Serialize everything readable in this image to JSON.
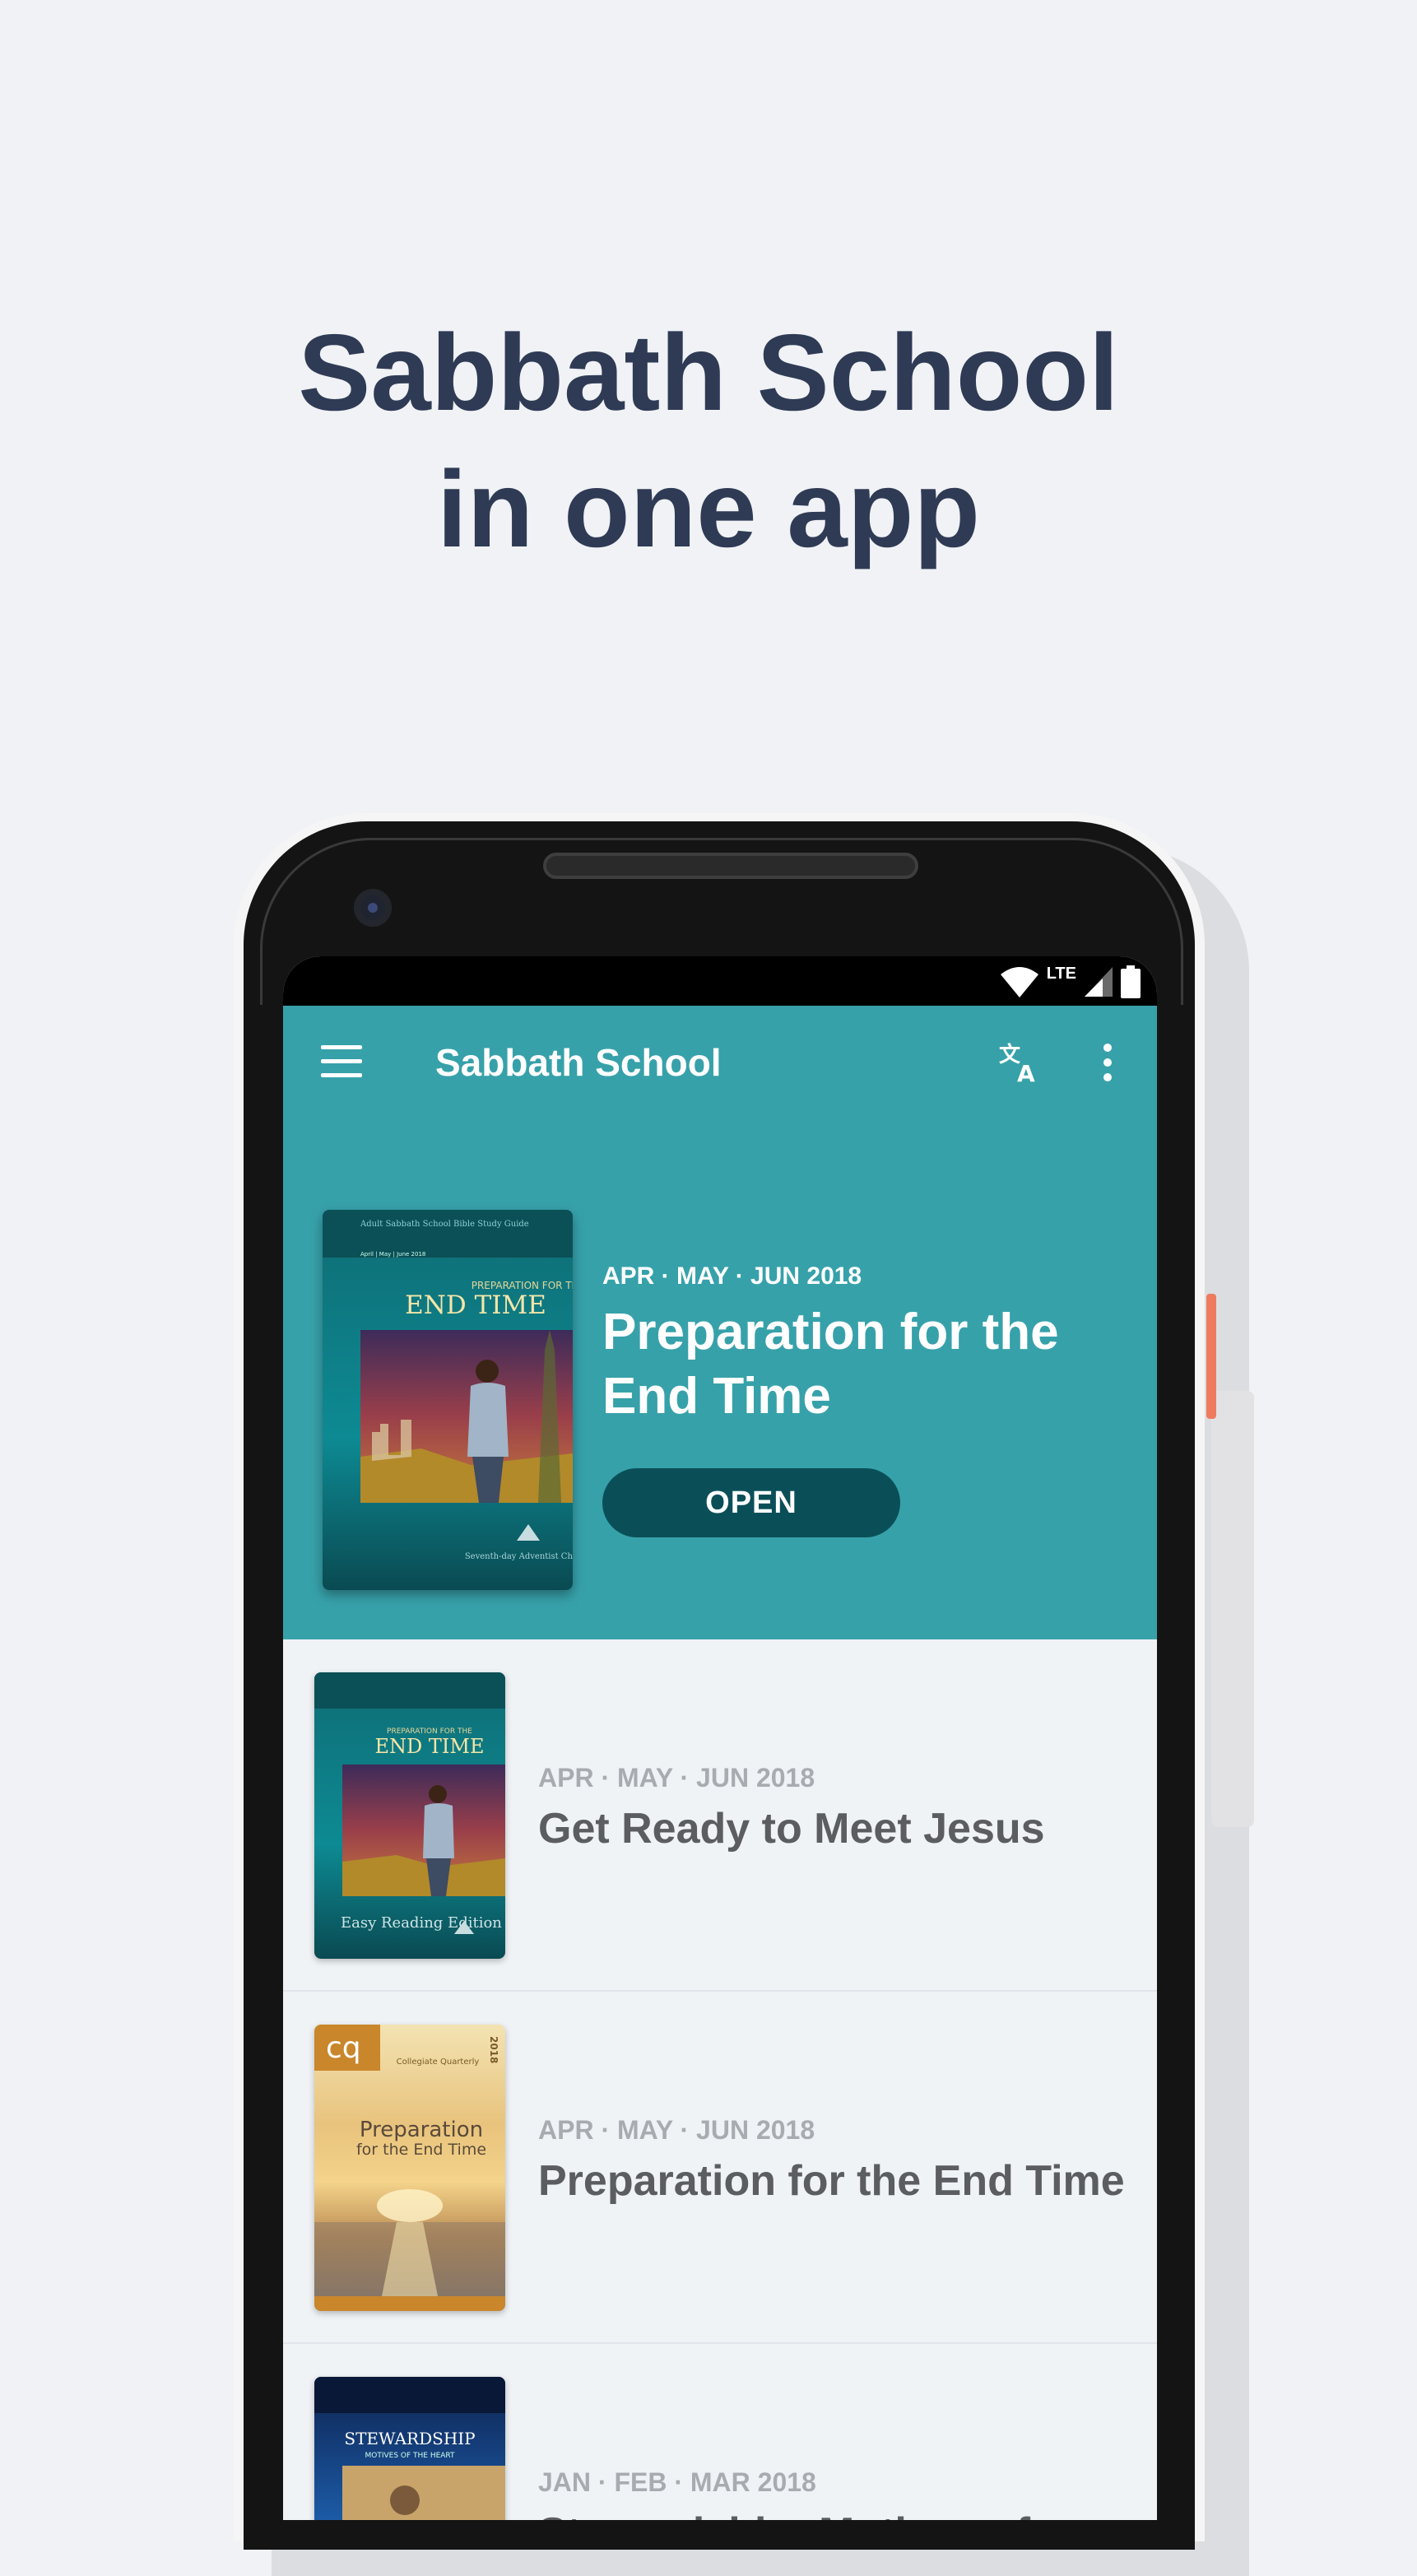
{
  "headline": {
    "line1": "Sabbath School",
    "line2": "in one app"
  },
  "status_bar": {
    "network_label": "LTE",
    "icons": [
      "wifi-icon",
      "cell-signal-icon",
      "battery-icon"
    ]
  },
  "app_bar": {
    "title": "Sabbath School",
    "icons": [
      "menu-icon",
      "translate-icon",
      "more-vert-icon"
    ],
    "color": "#37a1aa"
  },
  "featured": {
    "quarter": "APR · MAY · JUN 2018",
    "title": "Preparation for the End Time",
    "open_label": "OPEN",
    "cover": {
      "series": "Adult Sabbath School Bible Study Guide",
      "dates": "April | May | June 2018",
      "kicker": "PREPARATION FOR THE",
      "title": "END TIME",
      "publisher": "Seventh-day Adventist Church"
    }
  },
  "list": [
    {
      "quarter": "APR · MAY · JUN 2018",
      "title": "Get Ready to Meet Jesus",
      "cover": {
        "kicker": "PREPARATION FOR THE",
        "title": "END TIME",
        "edition": "Easy Reading Edition"
      }
    },
    {
      "quarter": "APR · MAY · JUN 2018",
      "title": "Preparation for the End Time",
      "cover": {
        "badge": "cq",
        "tagline": "Collegiate Quarterly",
        "year": "2018",
        "title_line1": "Preparation",
        "title_line2": "for the End Time"
      }
    },
    {
      "quarter": "JAN · FEB · MAR 2018",
      "title": "Stewardship: Motives of",
      "cover": {
        "title": "STEWARDSHIP",
        "subtitle": "MOTIVES OF THE HEART"
      }
    }
  ],
  "colors": {
    "background": "#f0f2f5",
    "headline": "#2f3b55",
    "open_button": "#0a4f58",
    "meta_text": "#a8acb1",
    "item_title": "#5b5d61"
  }
}
